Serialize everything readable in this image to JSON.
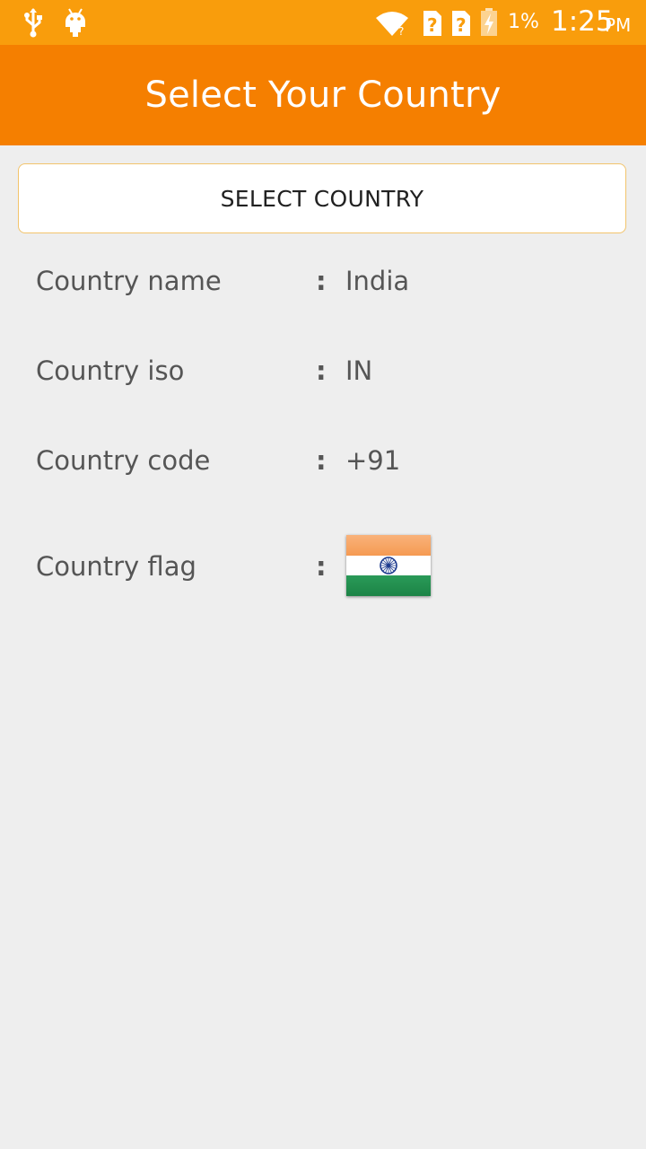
{
  "status_bar": {
    "battery_percent": "1%",
    "time": "1:25",
    "ampm": "PM",
    "icons": [
      "usb-icon",
      "android-icon",
      "wifi-icon",
      "sim-unknown-icon",
      "sim-unknown-icon",
      "battery-charging-icon"
    ],
    "background_color": "#f99d0c"
  },
  "app_bar": {
    "title": "Select Your Country",
    "background_color": "#f57f00"
  },
  "select_button": {
    "label": "SELECT COUNTRY"
  },
  "details": [
    {
      "label": "Country name",
      "separator": ":",
      "value": "India"
    },
    {
      "label": "Country iso",
      "separator": ":",
      "value": "IN"
    },
    {
      "label": "Country code",
      "separator": ":",
      "value": "+91"
    },
    {
      "label": "Country flag",
      "separator": ":",
      "value": "",
      "icon": "india-flag-icon"
    }
  ],
  "flag_colors": {
    "saffron": "#f7a35c",
    "white": "#ffffff",
    "green": "#1f8e4c",
    "chakra": "#1f3c8f"
  }
}
